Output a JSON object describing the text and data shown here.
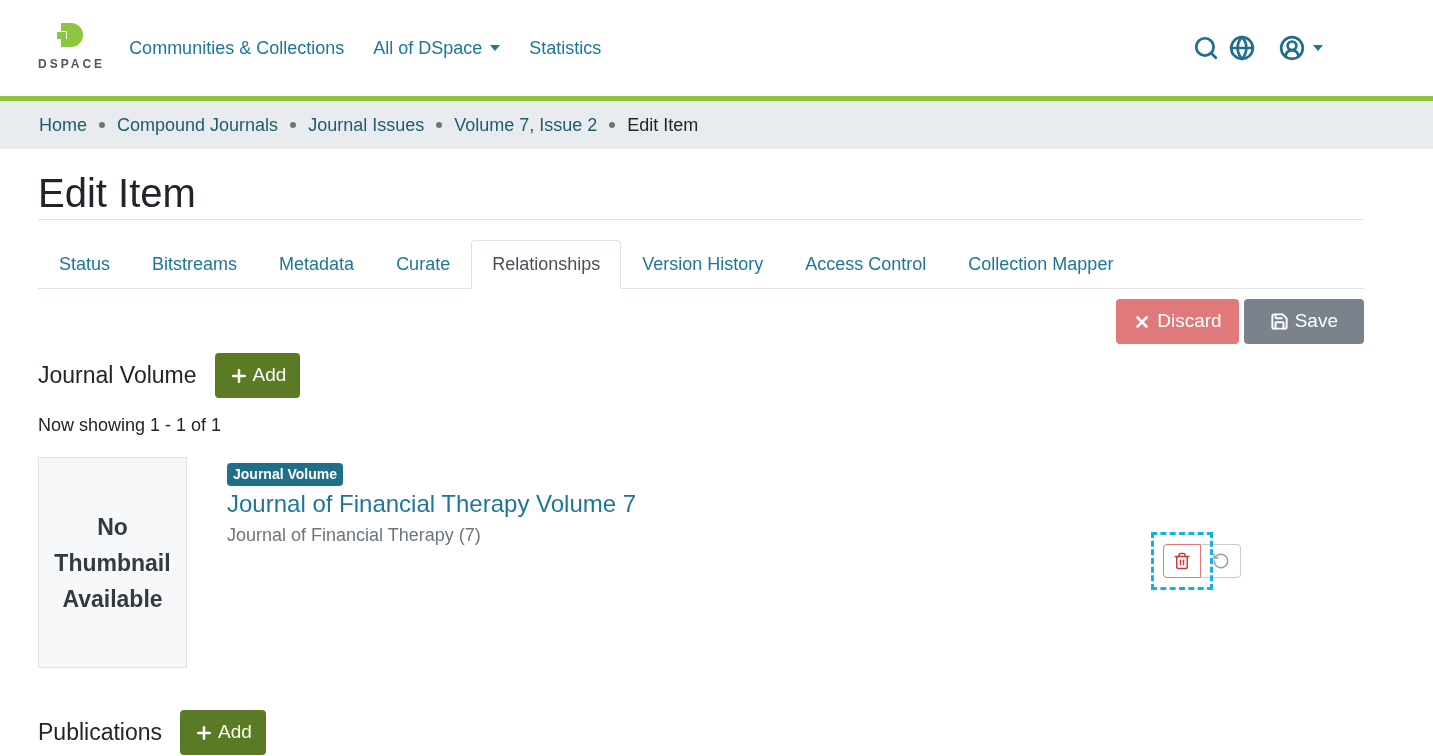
{
  "logo": {
    "text": "DSPACE"
  },
  "nav": [
    {
      "label": "Communities & Collections",
      "dropdown": false
    },
    {
      "label": "All of DSpace",
      "dropdown": true
    },
    {
      "label": "Statistics",
      "dropdown": false
    }
  ],
  "breadcrumb": [
    {
      "label": "Home",
      "current": false
    },
    {
      "label": "Compound Journals",
      "current": false
    },
    {
      "label": "Journal Issues",
      "current": false
    },
    {
      "label": "Volume 7, Issue 2",
      "current": false
    },
    {
      "label": "Edit Item",
      "current": true
    }
  ],
  "title": "Edit Item",
  "tabs": [
    {
      "label": "Status",
      "selected": false
    },
    {
      "label": "Bitstreams",
      "selected": false
    },
    {
      "label": "Metadata",
      "selected": false
    },
    {
      "label": "Curate",
      "selected": false
    },
    {
      "label": "Relationships",
      "selected": true
    },
    {
      "label": "Version History",
      "selected": false
    },
    {
      "label": "Access Control",
      "selected": false
    },
    {
      "label": "Collection Mapper",
      "selected": false
    }
  ],
  "actions": {
    "discard": "Discard",
    "save": "Save"
  },
  "sections": [
    {
      "heading": "Journal Volume",
      "add": "Add",
      "count": "Now showing 1 - 1 of 1",
      "items": [
        {
          "thumbnail": "No Thumbnail Available",
          "badge": "Journal Volume",
          "title": "Journal of Financial Therapy Volume 7",
          "subtitle": "Journal of Financial Therapy (7)",
          "delete_highlighted": true
        }
      ]
    },
    {
      "heading": "Publications",
      "add": "Add"
    }
  ]
}
